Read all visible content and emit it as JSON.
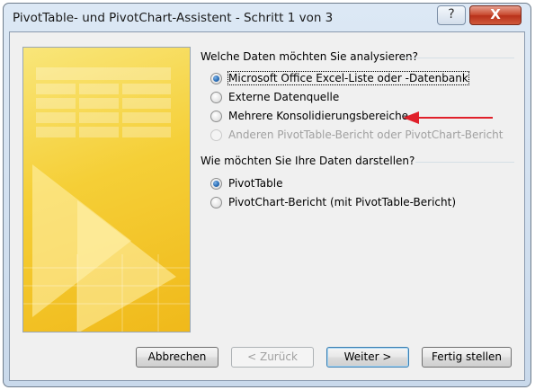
{
  "window": {
    "title": "PivotTable- und PivotChart-Assistent - Schritt 1 von 3",
    "help_icon": "?",
    "close_icon": "X"
  },
  "section1": {
    "heading": "Welche Daten möchten Sie analysieren?",
    "options": [
      {
        "label": "Microsoft Office Excel-Liste oder -Datenbank",
        "checked": true,
        "enabled": true
      },
      {
        "label": "Externe Datenquelle",
        "checked": false,
        "enabled": true
      },
      {
        "label": "Mehrere Konsolidierungsbereiche",
        "checked": false,
        "enabled": true
      },
      {
        "label": "Anderen PivotTable-Bericht oder PivotChart-Bericht",
        "checked": false,
        "enabled": false
      }
    ]
  },
  "section2": {
    "heading": "Wie möchten Sie Ihre Daten darstellen?",
    "options": [
      {
        "label": "PivotTable",
        "checked": true,
        "enabled": true
      },
      {
        "label": "PivotChart-Bericht (mit PivotTable-Bericht)",
        "checked": false,
        "enabled": true
      }
    ]
  },
  "buttons": {
    "cancel": "Abbrechen",
    "back": "< Zurück",
    "next": "Weiter >",
    "finish": "Fertig stellen"
  },
  "annotation": {
    "arrow_color": "#e0202a",
    "points_to": "Mehrere Konsolidierungsbereiche"
  },
  "colors": {
    "accent": "#2b6fb8",
    "art_yellow": "#f5cf37"
  }
}
